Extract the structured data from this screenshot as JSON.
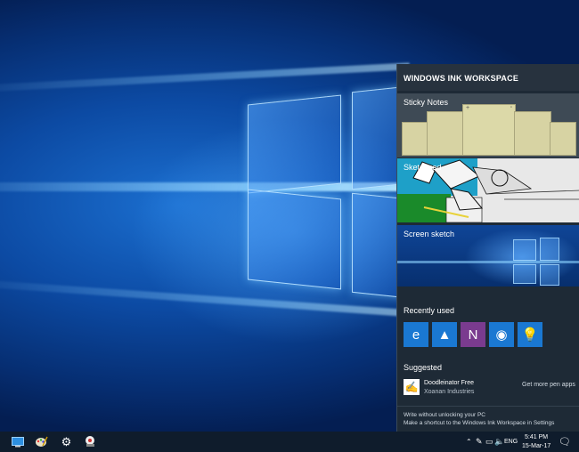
{
  "panel": {
    "title": "WINDOWS INK WORKSPACE",
    "sticky_notes_label": "Sticky Notes",
    "sketchpad_label": "Sketchpad",
    "screen_sketch_label": "Screen sketch",
    "recently_used_label": "Recently used",
    "recent_apps": [
      {
        "name": "edge-icon",
        "glyph": "e",
        "color": "#1a78d2"
      },
      {
        "name": "photos-icon",
        "glyph": "▲",
        "color": "#1a78d2"
      },
      {
        "name": "onenote-icon",
        "glyph": "N",
        "color": "#7a3b8f"
      },
      {
        "name": "maps-icon",
        "glyph": "◉",
        "color": "#1a78d2"
      },
      {
        "name": "tips-icon",
        "glyph": "💡",
        "color": "#1a78d2"
      }
    ],
    "suggested_label": "Suggested",
    "suggested_app": {
      "name": "Doodleinator Free",
      "publisher": "Xoanan Industries"
    },
    "get_more_label": "Get more pen apps",
    "footer_links": [
      "Write without unlocking your PC",
      "Make a shortcut to the Windows Ink Workspace in Settings"
    ]
  },
  "taskbar": {
    "language": "ENG",
    "time": "5:41 PM",
    "date": "15-Mar-17"
  }
}
